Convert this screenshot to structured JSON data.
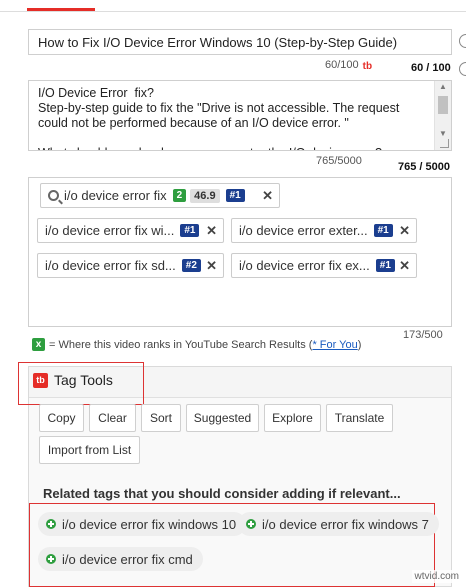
{
  "title": {
    "value": "How to Fix  I/O Device Error Windows 10 (Step-by-Step Guide)",
    "count": "60/100",
    "count_bold": "60 / 100"
  },
  "description": {
    "text": "I/O Device Error  fix?\nStep-by-step guide to fix the \"Drive is not accessible. The request could not be performed because of an I/O device error. \"\n\nWhat should you do when you encounter the I/O device error?",
    "count": "765/5000",
    "count_bold": "765 / 5000"
  },
  "tags": {
    "primary": {
      "label": "i/o device error fix",
      "count": "2",
      "score": "46.9",
      "rank": "#1"
    },
    "items": [
      {
        "label": "i/o device error fix wi...",
        "rank": "#1"
      },
      {
        "label": "i/o device error exter...",
        "rank": "#1"
      },
      {
        "label": "i/o device error fix sd...",
        "rank": "#2"
      },
      {
        "label": "i/o device error fix ex...",
        "rank": "#1"
      }
    ],
    "count": "173/500"
  },
  "legend": {
    "mark": "x",
    "text": "= Where this video ranks in YouTube Search Results (",
    "link": "* For You",
    "close": ")"
  },
  "tag_tools": {
    "logo": "tb",
    "title": "Tag Tools",
    "buttons": [
      "Copy",
      "Clear",
      "Sort",
      "Suggested",
      "Explore",
      "Translate",
      "Import from List"
    ]
  },
  "related": {
    "title": "Related tags that you should consider adding if relevant...",
    "items": [
      "i/o device error fix windows 10",
      "i/o device error fix windows 7",
      "i/o device error fix cmd"
    ]
  },
  "watermark": "wtvid.com",
  "colors": {
    "brand_red": "#e52d27",
    "rank_blue": "#1b3e8f",
    "count_green": "#2e9e3f",
    "highlight_red": "#dd3333"
  }
}
